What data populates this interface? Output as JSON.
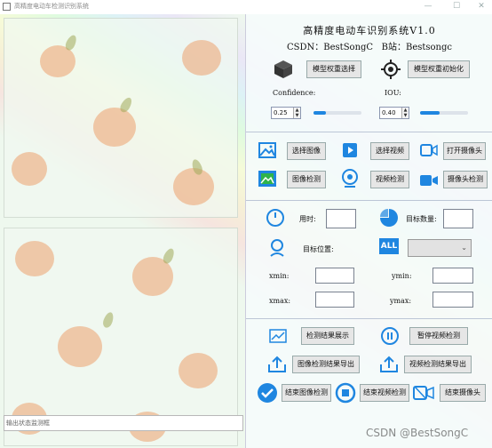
{
  "window": {
    "title": "高精度电动车检测识别系统",
    "controls": {
      "minimize": "—",
      "maximize": "☐",
      "close": "✕"
    }
  },
  "header": {
    "title": "高精度电动车识别系统V1.0",
    "csdn_label": "CSDN：",
    "csdn_value": "BestSongC",
    "bili_label": "B站：",
    "bili_value": "Bestsongc"
  },
  "model": {
    "select_button": "模型权重选择",
    "init_button": "模型权重初始化",
    "confidence_label": "Confidence:",
    "confidence_value": "0.25",
    "confidence_level": 0.25,
    "iou_label": "IOU:",
    "iou_value": "0.40",
    "iou_level": 0.4
  },
  "inputs": {
    "select_image": "选择图像",
    "select_video": "选择视频",
    "open_camera": "打开摄像头",
    "image_detect": "图像检测",
    "video_detect": "视频检测",
    "camera_detect": "摄像头检测"
  },
  "results": {
    "time_label": "用时:",
    "time_value": "",
    "count_label": "目标数量:",
    "count_value": "",
    "position_label": "目标位置:",
    "target_select_value": "",
    "xmin_label": "xmin:",
    "xmin_value": "",
    "ymin_label": "ymin:",
    "ymin_value": "",
    "xmax_label": "xmax:",
    "xmax_value": "",
    "ymax_label": "ymax:",
    "ymax_value": "",
    "all_badge": "ALL"
  },
  "actions": {
    "show_result": "检测结果展示",
    "pause_video": "暂停视频检测",
    "export_image": "图像检测结果导出",
    "export_video": "视频检测结果导出",
    "end_image": "结束图像检测",
    "end_video": "结束视频检测",
    "end_camera": "结束摄像头"
  },
  "status": {
    "placeholder": "输出状态监测框"
  },
  "watermark": "CSDN @BestSongC",
  "colors": {
    "accent": "#1f86e0",
    "background": "#eef8ee"
  }
}
